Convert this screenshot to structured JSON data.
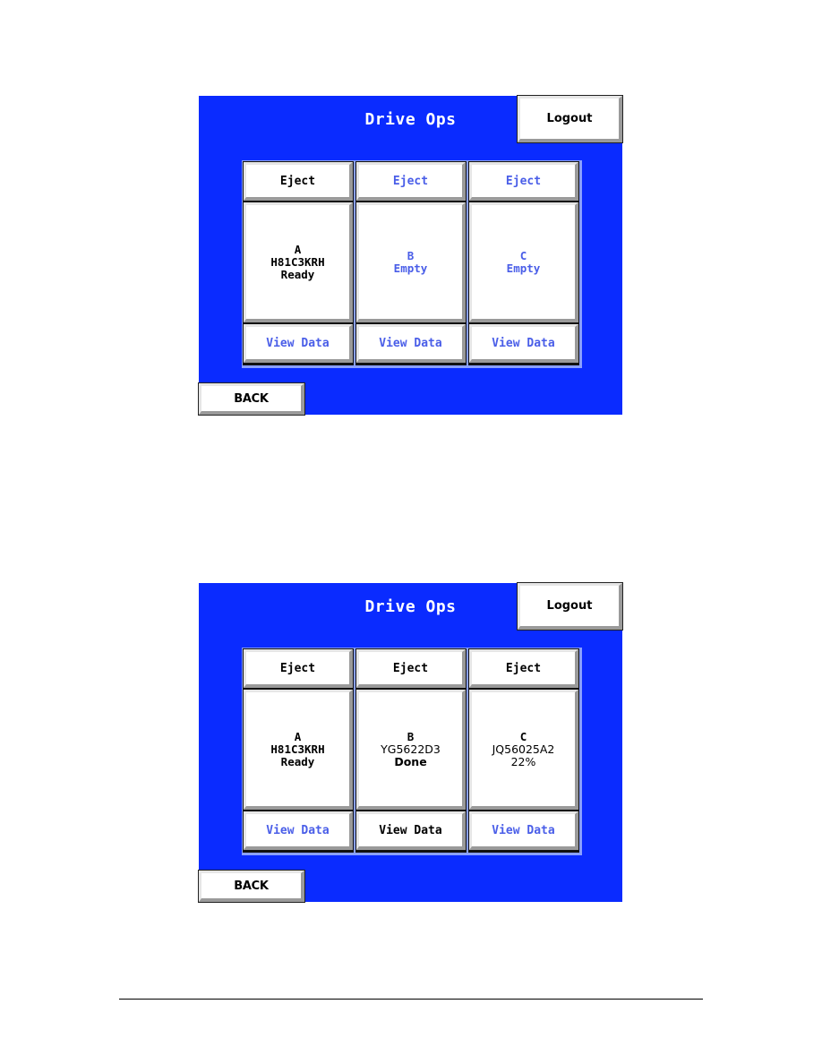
{
  "screens": [
    {
      "title": "Drive Ops",
      "logout_label": "Logout",
      "back_label": "BACK",
      "drives": [
        {
          "eject_label": "Eject",
          "eject_enabled": true,
          "letter": "A",
          "serial": "H81C3KRH",
          "status": "Ready",
          "view_label": "View Data",
          "view_enabled": false
        },
        {
          "eject_label": "Eject",
          "eject_enabled": false,
          "letter": "B",
          "serial": "",
          "status": "Empty",
          "view_label": "View Data",
          "view_enabled": false
        },
        {
          "eject_label": "Eject",
          "eject_enabled": false,
          "letter": "C",
          "serial": "",
          "status": "Empty",
          "view_label": "View Data",
          "view_enabled": false
        }
      ]
    },
    {
      "title": "Drive Ops",
      "logout_label": "Logout",
      "back_label": "BACK",
      "drives": [
        {
          "eject_label": "Eject",
          "eject_enabled": true,
          "letter": "A",
          "serial": "H81C3KRH",
          "status": "Ready",
          "view_label": "View Data",
          "view_enabled": false
        },
        {
          "eject_label": "Eject",
          "eject_enabled": true,
          "letter": "B",
          "serial": "YG5622D3",
          "status": "Done",
          "view_label": "View Data",
          "view_enabled": true
        },
        {
          "eject_label": "Eject",
          "eject_enabled": true,
          "letter": "C",
          "serial": "JQ56025A2",
          "status": "22%",
          "view_label": "View Data",
          "view_enabled": false
        }
      ]
    }
  ],
  "colors": {
    "screen_bg": "#0a2bff",
    "enabled_text": "#000000",
    "disabled_text": "#4a5ee8"
  }
}
